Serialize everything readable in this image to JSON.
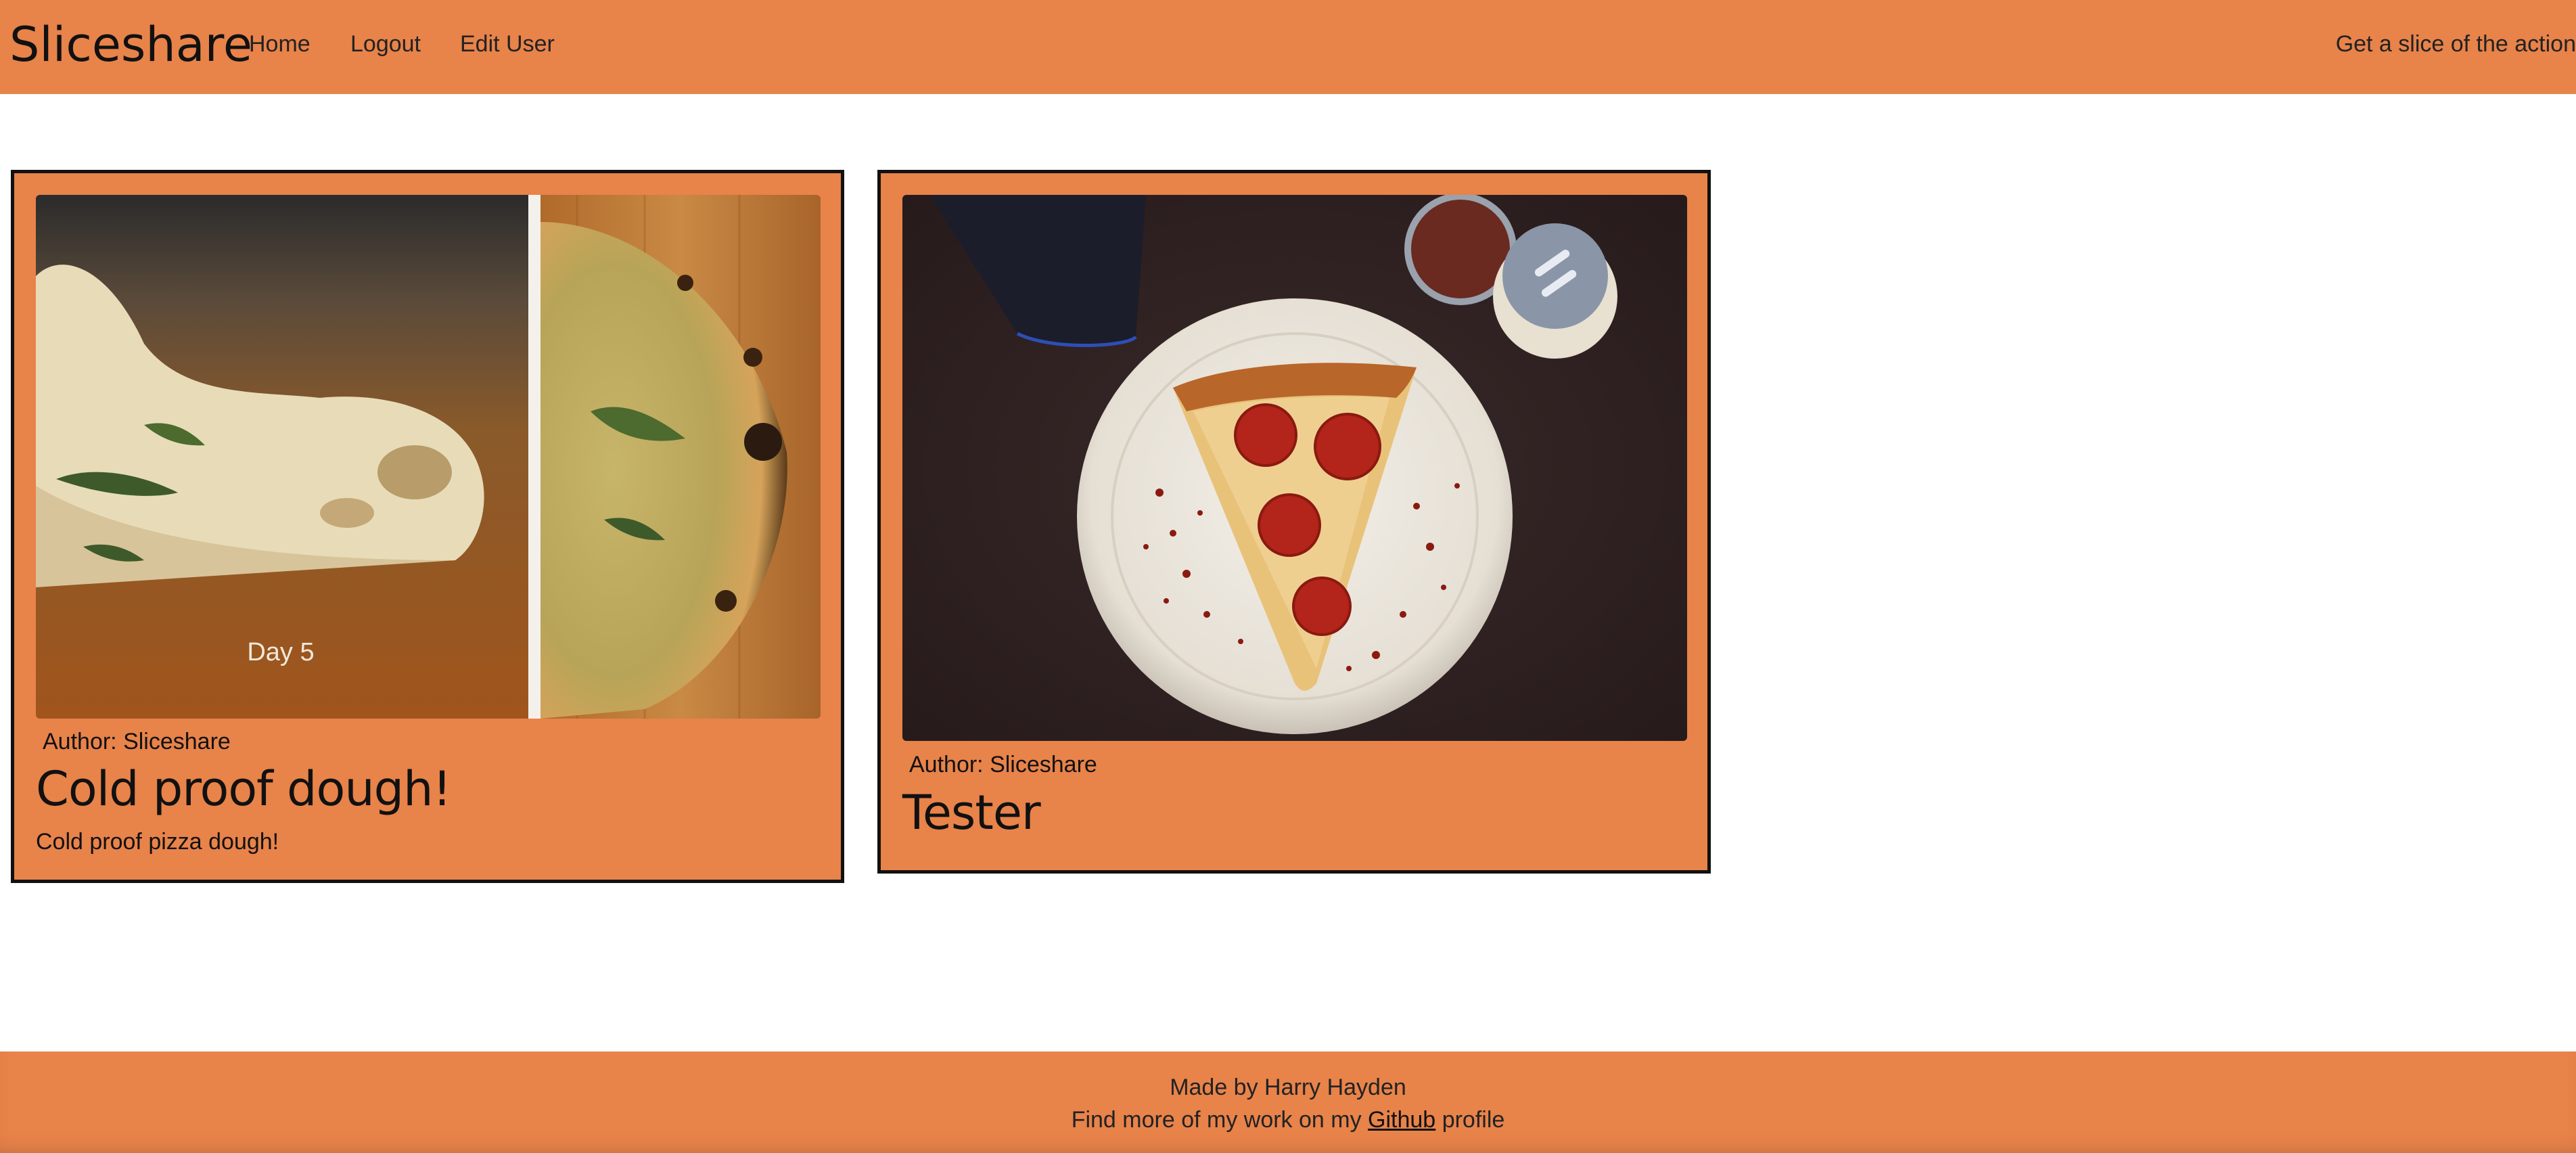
{
  "header": {
    "brand": "Sliceshare",
    "nav": {
      "home": "Home",
      "logout": "Logout",
      "edit_user": "Edit User"
    },
    "tagline": "Get a slice of the action"
  },
  "posts": [
    {
      "image_alt": "Cold proof pizza dough, Day 5",
      "image_caption": "Day 5",
      "author": "Author: Sliceshare",
      "title": "Cold proof dough!",
      "description": "Cold proof pizza dough!"
    },
    {
      "image_alt": "Pepperoni pizza slice on a white plate",
      "author": "Author: Sliceshare",
      "title": "Tester",
      "description": ""
    }
  ],
  "footer": {
    "line1": "Made by Harry Hayden",
    "line2_prefix": "Find more of my work on my",
    "github_link": "Github",
    "line2_suffix": "profile"
  },
  "colors": {
    "accent": "#e8834a",
    "border": "#111111",
    "background": "#ffffff"
  }
}
